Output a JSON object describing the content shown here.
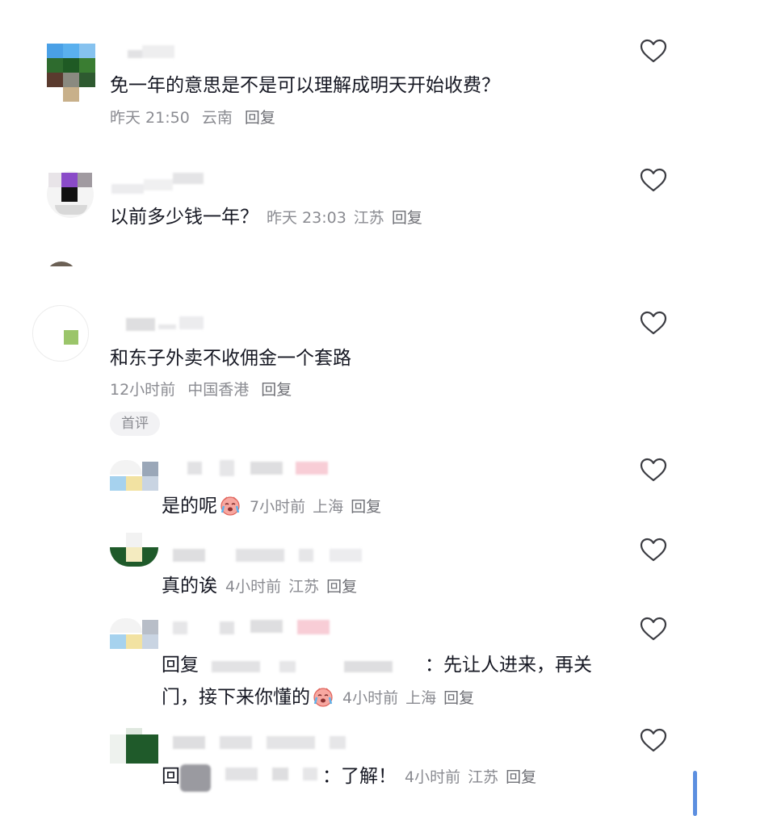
{
  "comments": [
    {
      "text": "免一年的意思是不是可以理解成明天开始收费？",
      "time": "昨天 21:50",
      "location": "云南",
      "reply_label": "回复"
    },
    {
      "text": "以前多少钱一年？",
      "time": "昨天 23:03",
      "location": "江苏",
      "reply_label": "回复"
    },
    {
      "text": "和东子外卖不收佣金一个套路",
      "time": "12小时前",
      "location": "中国香港",
      "reply_label": "回复",
      "badge": "首评"
    }
  ],
  "replies": [
    {
      "text": "是的呢",
      "time": "7小时前",
      "location": "上海",
      "reply_label": "回复",
      "emoji": "crying-face-emoji"
    },
    {
      "text": "真的诶",
      "time": "4小时前",
      "location": "江苏",
      "reply_label": "回复"
    },
    {
      "prefix": "回复",
      "text_line1": "：先让人进来，再关",
      "text_line2": "门，接下来你懂的",
      "time": "4小时前",
      "location": "上海",
      "reply_label": "回复",
      "emoji": "crying-face-emoji"
    },
    {
      "prefix": "回",
      "text": "：了解！",
      "time": "4小时前",
      "location": "江苏",
      "reply_label": "回复"
    }
  ],
  "icons": {
    "like": "heart-outline-icon"
  },
  "colors": {
    "text": "#161823",
    "meta": "#8a8b91",
    "scrollbar": "#5c8fe0"
  }
}
